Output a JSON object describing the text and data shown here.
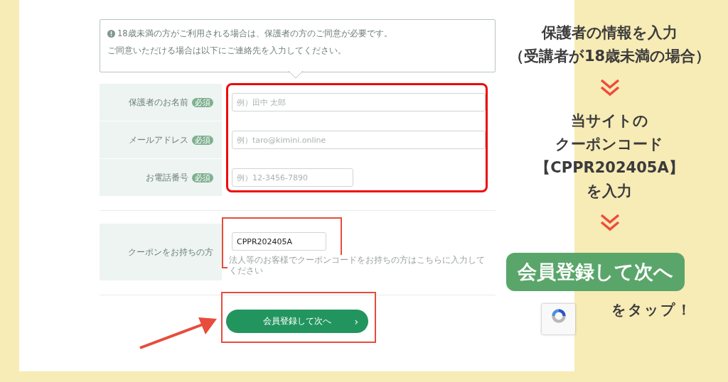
{
  "notice": {
    "lines": [
      "18歳未満の方がご利用される場合は、保護者の方のご同意が必要です。",
      "ご同意いただける場合は以下にご連絡先を入力してください。"
    ]
  },
  "guardian_fields": [
    {
      "label": "保護者のお名前",
      "badge": "必須",
      "placeholder": "例）田中 太郎",
      "wide": true
    },
    {
      "label": "メールアドレス",
      "badge": "必須",
      "placeholder": "例）taro@kimini.online",
      "wide": true
    },
    {
      "label": "お電話番号",
      "badge": "必須",
      "placeholder": "例）12-3456-7890",
      "wide": false
    }
  ],
  "coupon": {
    "label": "クーポンをお持ちの方",
    "value": "CPPR202405A",
    "hint": "法人等のお客様でクーポンコードをお持ちの方はこちらに入力してください"
  },
  "submit_button": {
    "label": "会員登録して次へ",
    "arrow": "›"
  },
  "annotations": [
    {
      "kind": "text",
      "lines": [
        "保護者の情報を入力",
        "（受講者が18歳未満の場合）"
      ]
    },
    {
      "kind": "chevron"
    },
    {
      "kind": "text",
      "lines": [
        "当サイトの",
        "クーポンコード",
        "【CPPR202405A】",
        "を入力"
      ]
    },
    {
      "kind": "chevron"
    },
    {
      "kind": "button",
      "label": "会員登録して次へ"
    },
    {
      "kind": "note",
      "label": "をタップ！"
    }
  ]
}
